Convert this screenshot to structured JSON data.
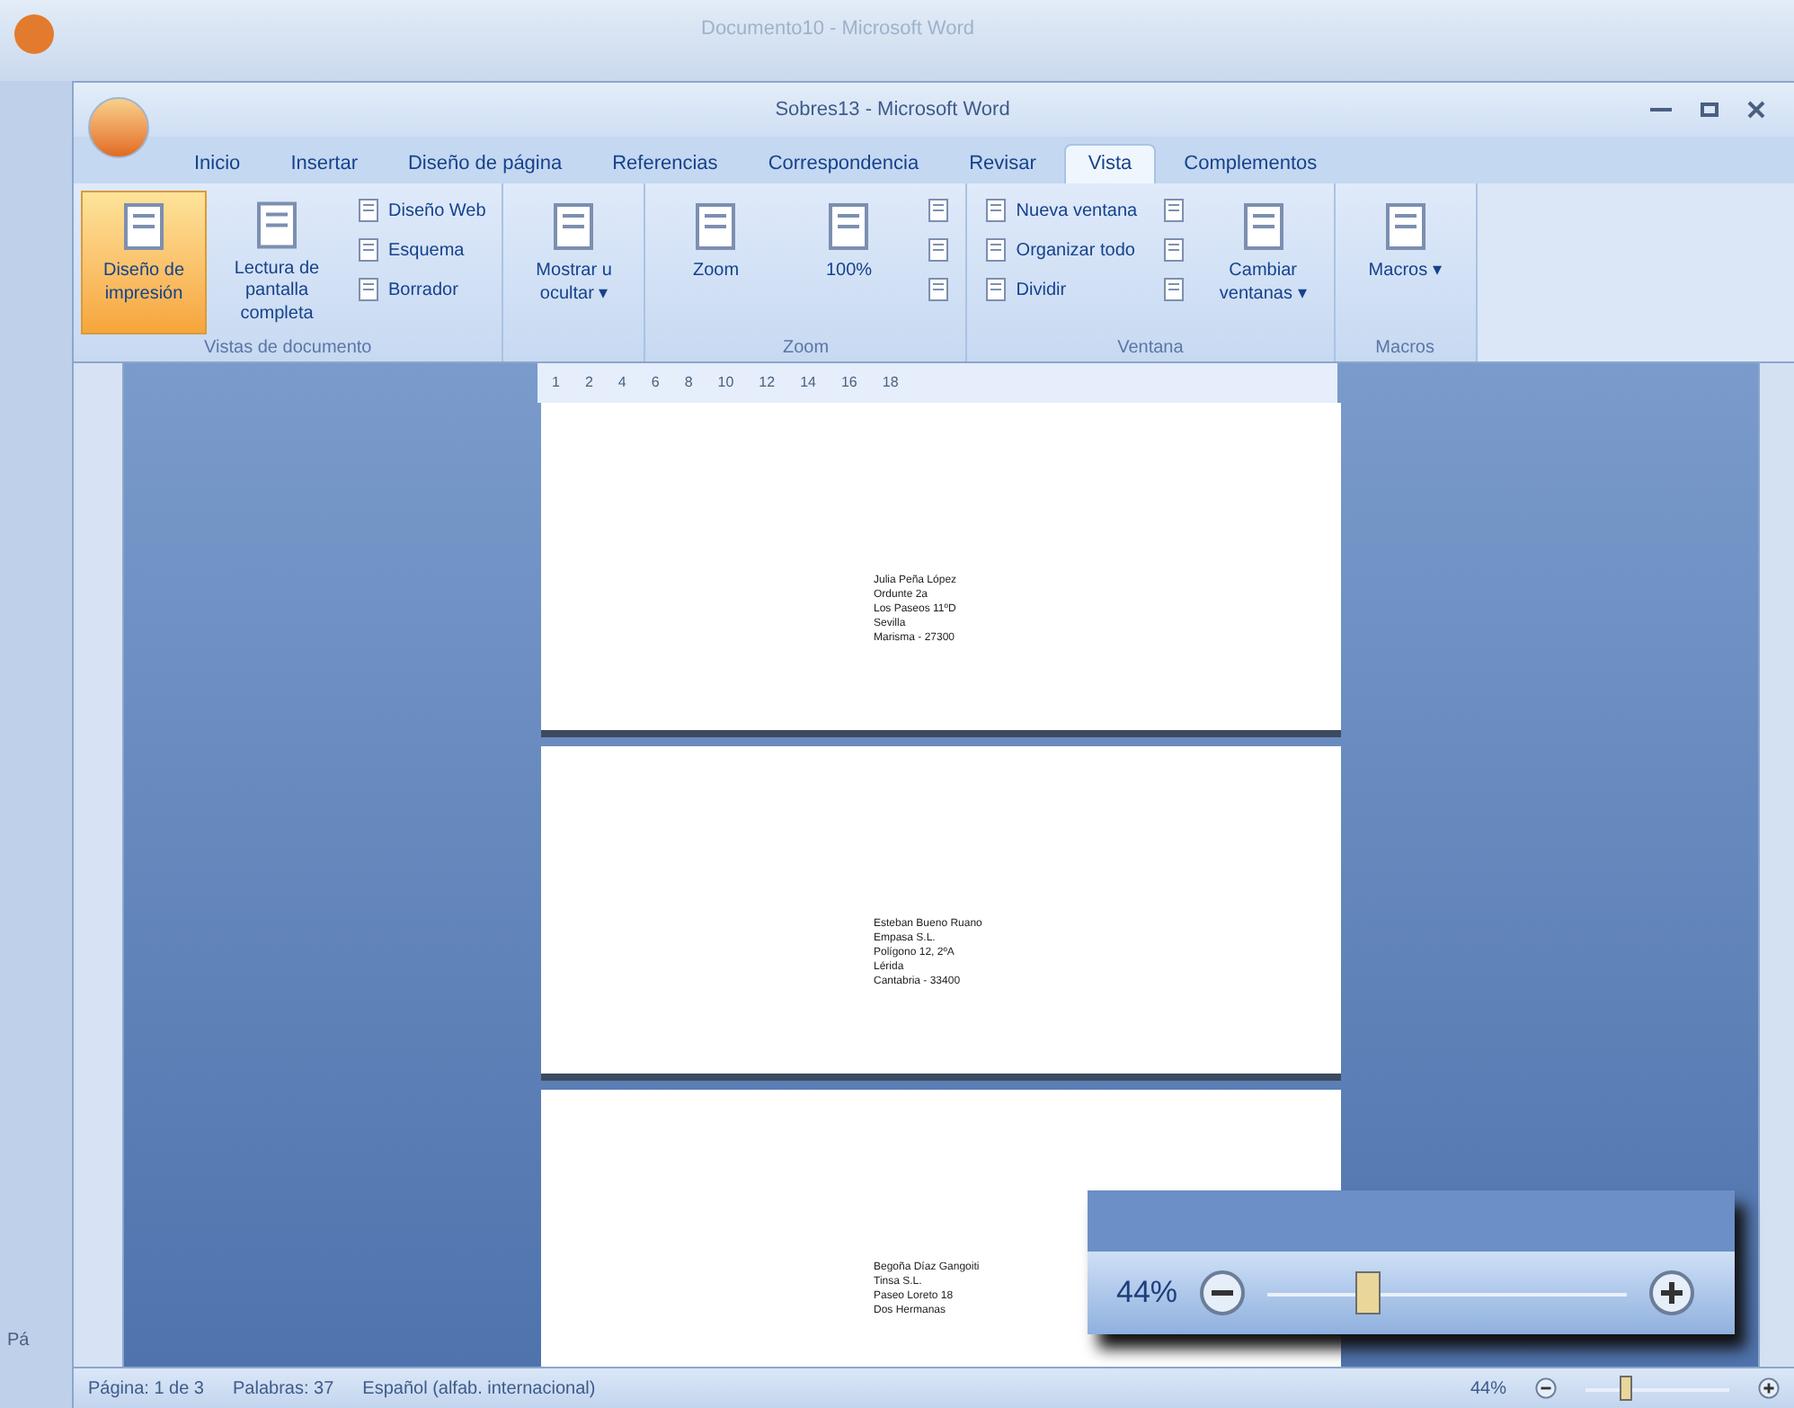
{
  "background_window": {
    "title": "Documento10 - Microsoft Word",
    "side_label": "Pá"
  },
  "window": {
    "title": "Sobres13 - Microsoft Word"
  },
  "tabs": [
    {
      "label": "Inicio",
      "selected": false
    },
    {
      "label": "Insertar",
      "selected": false
    },
    {
      "label": "Diseño de página",
      "selected": false
    },
    {
      "label": "Referencias",
      "selected": false
    },
    {
      "label": "Correspondencia",
      "selected": false
    },
    {
      "label": "Revisar",
      "selected": false
    },
    {
      "label": "Vista",
      "selected": true
    },
    {
      "label": "Complementos",
      "selected": false
    }
  ],
  "ribbon_groups": [
    {
      "label": "Vistas de documento",
      "buttons": [
        {
          "kind": "large",
          "label": "Diseño de impresión",
          "selected": true
        },
        {
          "kind": "large",
          "label": "Lectura de pantalla completa",
          "selected": false
        },
        {
          "kind": "small",
          "label": "Diseño Web",
          "selected": false
        },
        {
          "kind": "small",
          "label": "Esquema",
          "selected": false
        },
        {
          "kind": "small",
          "label": "Borrador",
          "selected": false
        }
      ]
    },
    {
      "buttons": [
        {
          "kind": "large",
          "label": "Mostrar u ocultar ▾"
        }
      ]
    },
    {
      "label": "Zoom",
      "buttons": [
        {
          "kind": "large",
          "label": "Zoom"
        },
        {
          "kind": "large",
          "label": "100%"
        },
        {
          "kind": "icon"
        },
        {
          "kind": "icon"
        },
        {
          "kind": "icon"
        }
      ]
    },
    {
      "label": "Ventana",
      "buttons": [
        {
          "kind": "small",
          "label": "Nueva ventana"
        },
        {
          "kind": "small",
          "label": "Organizar todo"
        },
        {
          "kind": "small",
          "label": "Dividir"
        },
        {
          "kind": "icon"
        },
        {
          "kind": "icon"
        },
        {
          "kind": "icon"
        },
        {
          "kind": "large",
          "label": "Cambiar ventanas ▾"
        }
      ]
    },
    {
      "label": "Macros",
      "buttons": [
        {
          "kind": "large",
          "label": "Macros ▾"
        }
      ]
    }
  ],
  "ruler_labels": [
    "1",
    "2",
    "4",
    "6",
    "8",
    "10",
    "12",
    "14",
    "16",
    "18"
  ],
  "pages": [
    {
      "address_lines": [
        "Julia Peña López",
        "Ordunte 2a",
        "Los Paseos 11ºD",
        "Sevilla",
        "Marisma - 27300"
      ]
    },
    {
      "address_lines": [
        "Esteban Bueno Ruano",
        "Empasa S.L.",
        "Polígono 12, 2ºA",
        "Lérida",
        "Cantabria - 33400"
      ]
    },
    {
      "address_lines": [
        "Begoña Díaz Gangoiti",
        "Tinsa S.L.",
        "Paseo Loreto 18",
        "Dos Hermanas"
      ]
    }
  ],
  "zoom_popup": {
    "reading": "44%",
    "level": 0.28
  },
  "status_bar": {
    "items": [
      "Página: 1 de 3",
      "Palabras: 37",
      "Español (alfab. internacional)"
    ],
    "zoom": "44%",
    "level": 0.28
  }
}
